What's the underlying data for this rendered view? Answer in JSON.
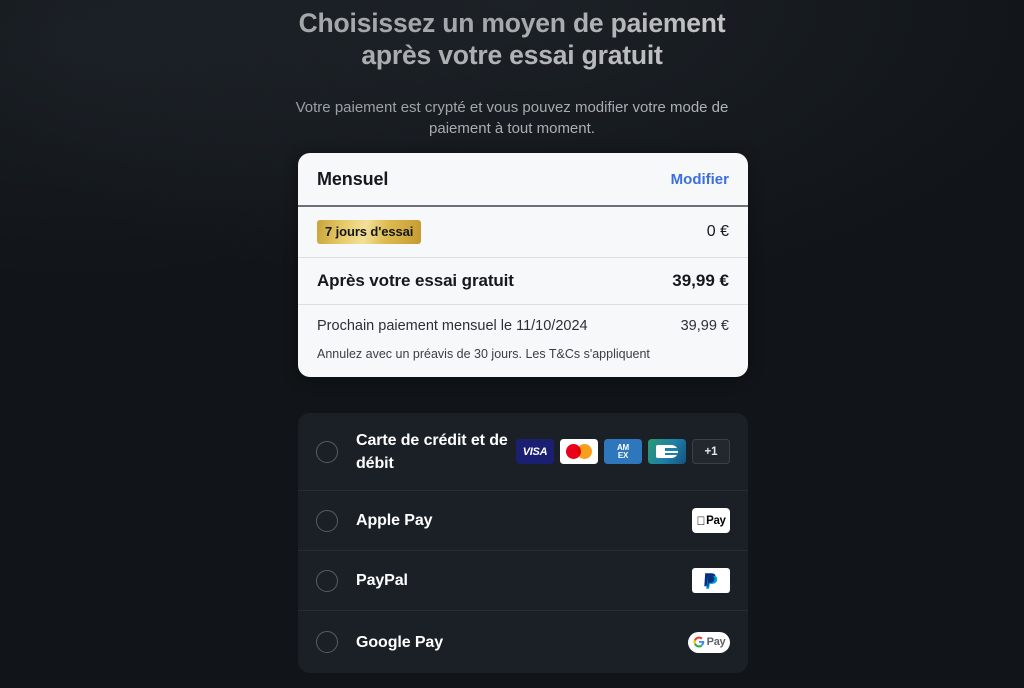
{
  "header": {
    "title": "Choisissez un moyen de paiement après votre essai gratuit",
    "subtitle": "Votre paiement est crypté et vous pouvez modifier votre mode de paiement à tout moment."
  },
  "plan_card": {
    "plan_name": "Mensuel",
    "edit_label": "Modifier",
    "trial_badge": "7 jours d'essai",
    "trial_price": "0 €",
    "after_trial_label": "Après votre essai gratuit",
    "after_trial_price": "39,99 €",
    "next_payment_label": "Prochain paiement mensuel le 11/10/2024",
    "next_payment_price": "39,99 €",
    "fineprint": "Annulez avec un préavis de 30 jours. Les T&Cs s'appliquent",
    "link_color": "#3b6fe0",
    "badge_color": "#ddbb52"
  },
  "payment_methods": [
    {
      "id": "card",
      "label": "Carte de crédit et de débit",
      "selected": false,
      "brands": [
        "VISA",
        "mastercard-icon",
        "AMEX",
        "cb-icon",
        "+1"
      ],
      "more_label": "+1",
      "visa_label": "VISA",
      "amex_line1": "AM",
      "amex_line2": "EX"
    },
    {
      "id": "apple-pay",
      "label": "Apple Pay",
      "selected": false,
      "chip_label": "Pay"
    },
    {
      "id": "paypal",
      "label": "PayPal",
      "selected": false
    },
    {
      "id": "google-pay",
      "label": "Google Pay",
      "selected": false,
      "chip_label": "Pay"
    }
  ],
  "theme": {
    "background": "#111519",
    "panel": "#1b2026",
    "card": "#f7f8f9"
  }
}
